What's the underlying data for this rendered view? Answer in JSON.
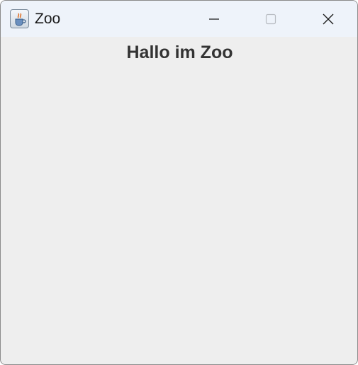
{
  "window": {
    "title": "Zoo",
    "app_icon": "java-coffee-cup-icon",
    "controls": {
      "minimize_icon": "minimize-icon",
      "maximize_icon": "maximize-icon",
      "close_icon": "close-icon"
    }
  },
  "content": {
    "heading": "Hallo im Zoo"
  },
  "colors": {
    "titlebar": "#eef3fa",
    "content_background": "#eeeeee",
    "heading_text": "#333333"
  }
}
